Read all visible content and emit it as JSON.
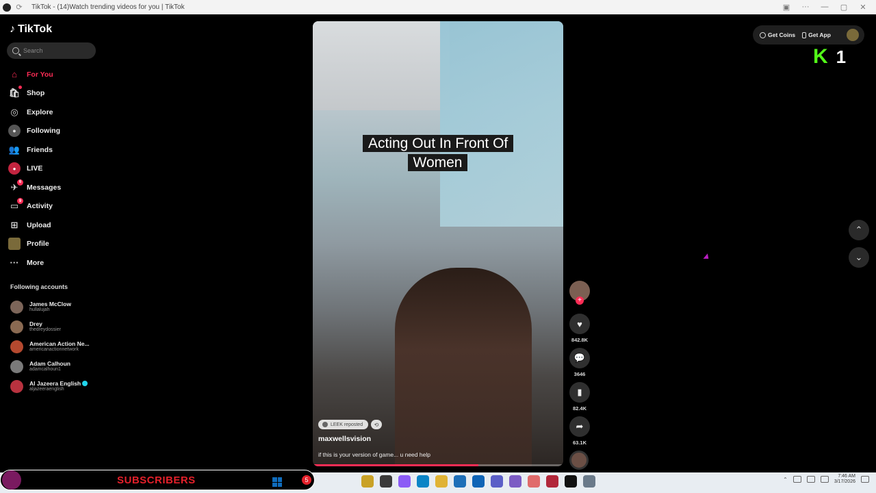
{
  "browser": {
    "tab_title": "TikTok - (14)Watch trending videos for you | TikTok"
  },
  "sidebar": {
    "logo": "TikTok",
    "search_placeholder": "Search",
    "nav": [
      {
        "label": "For You",
        "icon": "home-icon",
        "active": true
      },
      {
        "label": "Shop",
        "icon": "shop-icon",
        "active": false
      },
      {
        "label": "Explore",
        "icon": "compass-icon",
        "active": false
      },
      {
        "label": "Following",
        "icon": "following-icon",
        "active": false
      },
      {
        "label": "Friends",
        "icon": "friends-icon",
        "active": false
      },
      {
        "label": "LIVE",
        "icon": "live-icon",
        "active": false
      },
      {
        "label": "Messages",
        "icon": "messages-icon",
        "active": false,
        "badge": "6"
      },
      {
        "label": "Activity",
        "icon": "activity-icon",
        "active": false,
        "badge": "9"
      },
      {
        "label": "Upload",
        "icon": "upload-icon",
        "active": false
      },
      {
        "label": "Profile",
        "icon": "profile-icon",
        "active": false
      },
      {
        "label": "More",
        "icon": "more-icon",
        "active": false
      }
    ],
    "following_title": "Following accounts",
    "accounts": [
      {
        "name": "James McClow",
        "handle": "hullalujah"
      },
      {
        "name": "Drey",
        "handle": "thedreydossier"
      },
      {
        "name": "American Action Ne...",
        "handle": "americanactionnetwork"
      },
      {
        "name": "Adam Calhoun",
        "handle": "adamcalhoun1"
      },
      {
        "name": "Al Jazeera English",
        "handle": "aljazeeraenglish",
        "verified": true
      }
    ]
  },
  "video": {
    "caption": "Acting Out In Front Of Women",
    "repost_label": "LEEK reposted",
    "username": "maxwellsvision",
    "description": "if this is your version of game... u need help",
    "progress": 0.66
  },
  "actions": {
    "likes": "842.8K",
    "comments": "3646",
    "saves": "82.4K",
    "shares": "63.1K"
  },
  "topbar": {
    "get_coins": "Get Coins",
    "get_app": "Get App"
  },
  "overlay": {
    "kick_number": "1",
    "subscribers_label": "SUBSCRIBERS",
    "subscribers_count": "5"
  },
  "taskbar": {
    "time": "7:46 AM",
    "date": "3/17/2026"
  },
  "colors": {
    "accent": "#fe2c55",
    "kick_green": "#53fc18",
    "subscriber_red": "#e4202a"
  }
}
